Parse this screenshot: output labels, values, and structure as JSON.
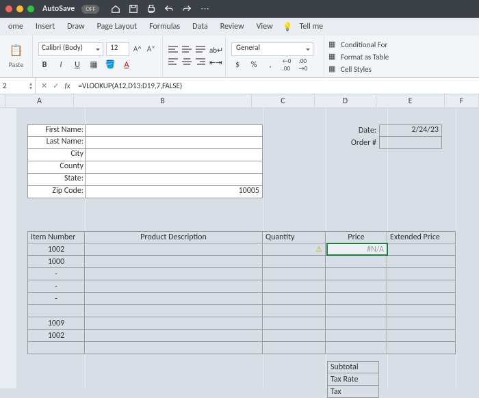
{
  "titlebar": {
    "autosave": "AutoSave",
    "state": "OFF"
  },
  "tabs": [
    "ome",
    "Insert",
    "Draw",
    "Page Layout",
    "Formulas",
    "Data",
    "Review",
    "View",
    "Tell me"
  ],
  "font": {
    "name": "Calibri (Body)",
    "size": "12",
    "aUp": "A^",
    "aDn": "A˅"
  },
  "buttons": {
    "b": "B",
    "i": "I",
    "u": "U"
  },
  "number": {
    "format": "General",
    "dollar": "$",
    "pct": "%",
    "comma": ","
  },
  "styles": {
    "cond": "Conditional For",
    "fmt": "Format as Table",
    "cell": "Cell Styles"
  },
  "namebox": "2",
  "formula": "=VLOOKUP(A12,D13:D19,7,FALSE)",
  "cols": [
    "A",
    "B",
    "C",
    "D",
    "E",
    "F"
  ],
  "form1": {
    "labels": [
      "First Name:",
      "Last Name:",
      "City",
      "County",
      "State:",
      "Zip Code:"
    ],
    "zip": "10005"
  },
  "form2": {
    "dateLbl": "Date:",
    "date": "2/24/23",
    "orderLbl": "Order #"
  },
  "table": {
    "headers": [
      "Item Number",
      "Product Description",
      "Quantity",
      "Price",
      "Extended Price"
    ],
    "items": [
      "1002",
      "1000",
      "-",
      "-",
      "-",
      "",
      "1009",
      "1002"
    ],
    "priceErr": "#N/A"
  },
  "subtotal": [
    "Subtotal",
    "Tax Rate",
    "Tax"
  ]
}
